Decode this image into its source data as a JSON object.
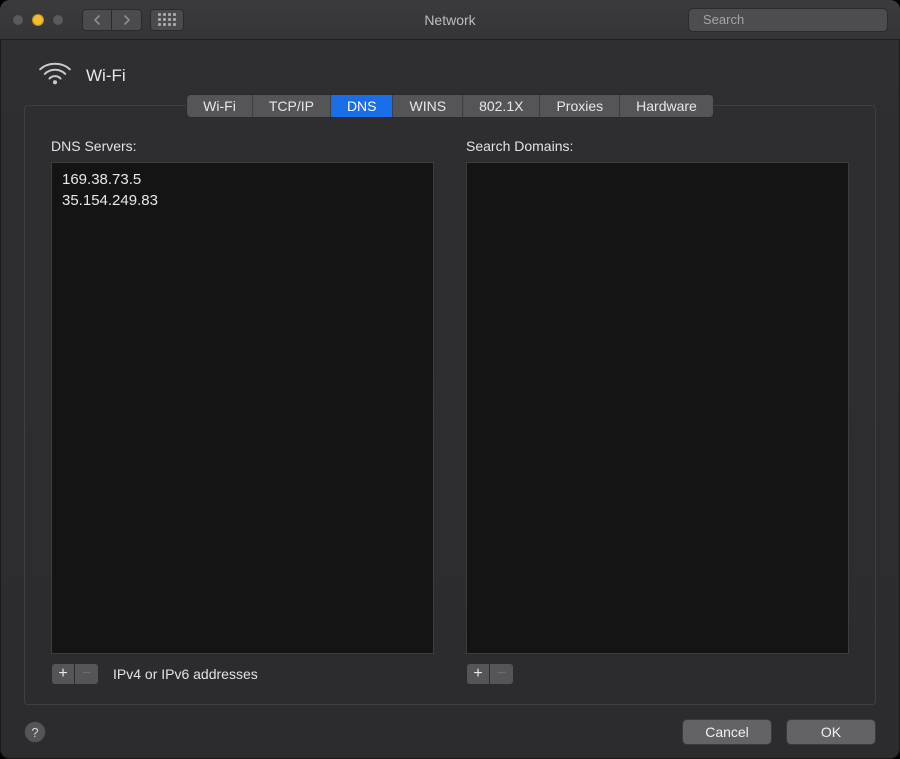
{
  "window": {
    "title": "Network",
    "search_placeholder": "Search"
  },
  "header": {
    "page_title": "Wi-Fi"
  },
  "tabs": [
    {
      "label": "Wi-Fi",
      "active": false
    },
    {
      "label": "TCP/IP",
      "active": false
    },
    {
      "label": "DNS",
      "active": true
    },
    {
      "label": "WINS",
      "active": false
    },
    {
      "label": "802.1X",
      "active": false
    },
    {
      "label": "Proxies",
      "active": false
    },
    {
      "label": "Hardware",
      "active": false
    }
  ],
  "dns": {
    "label": "DNS Servers:",
    "servers": [
      "169.38.73.5",
      "35.154.249.83"
    ],
    "hint": "IPv4 or IPv6 addresses",
    "plus_symbol": "+",
    "minus_symbol": "−"
  },
  "search_domains": {
    "label": "Search Domains:",
    "domains": [],
    "plus_symbol": "+",
    "minus_symbol": "−"
  },
  "footer": {
    "help_symbol": "?",
    "cancel_label": "Cancel",
    "ok_label": "OK"
  }
}
